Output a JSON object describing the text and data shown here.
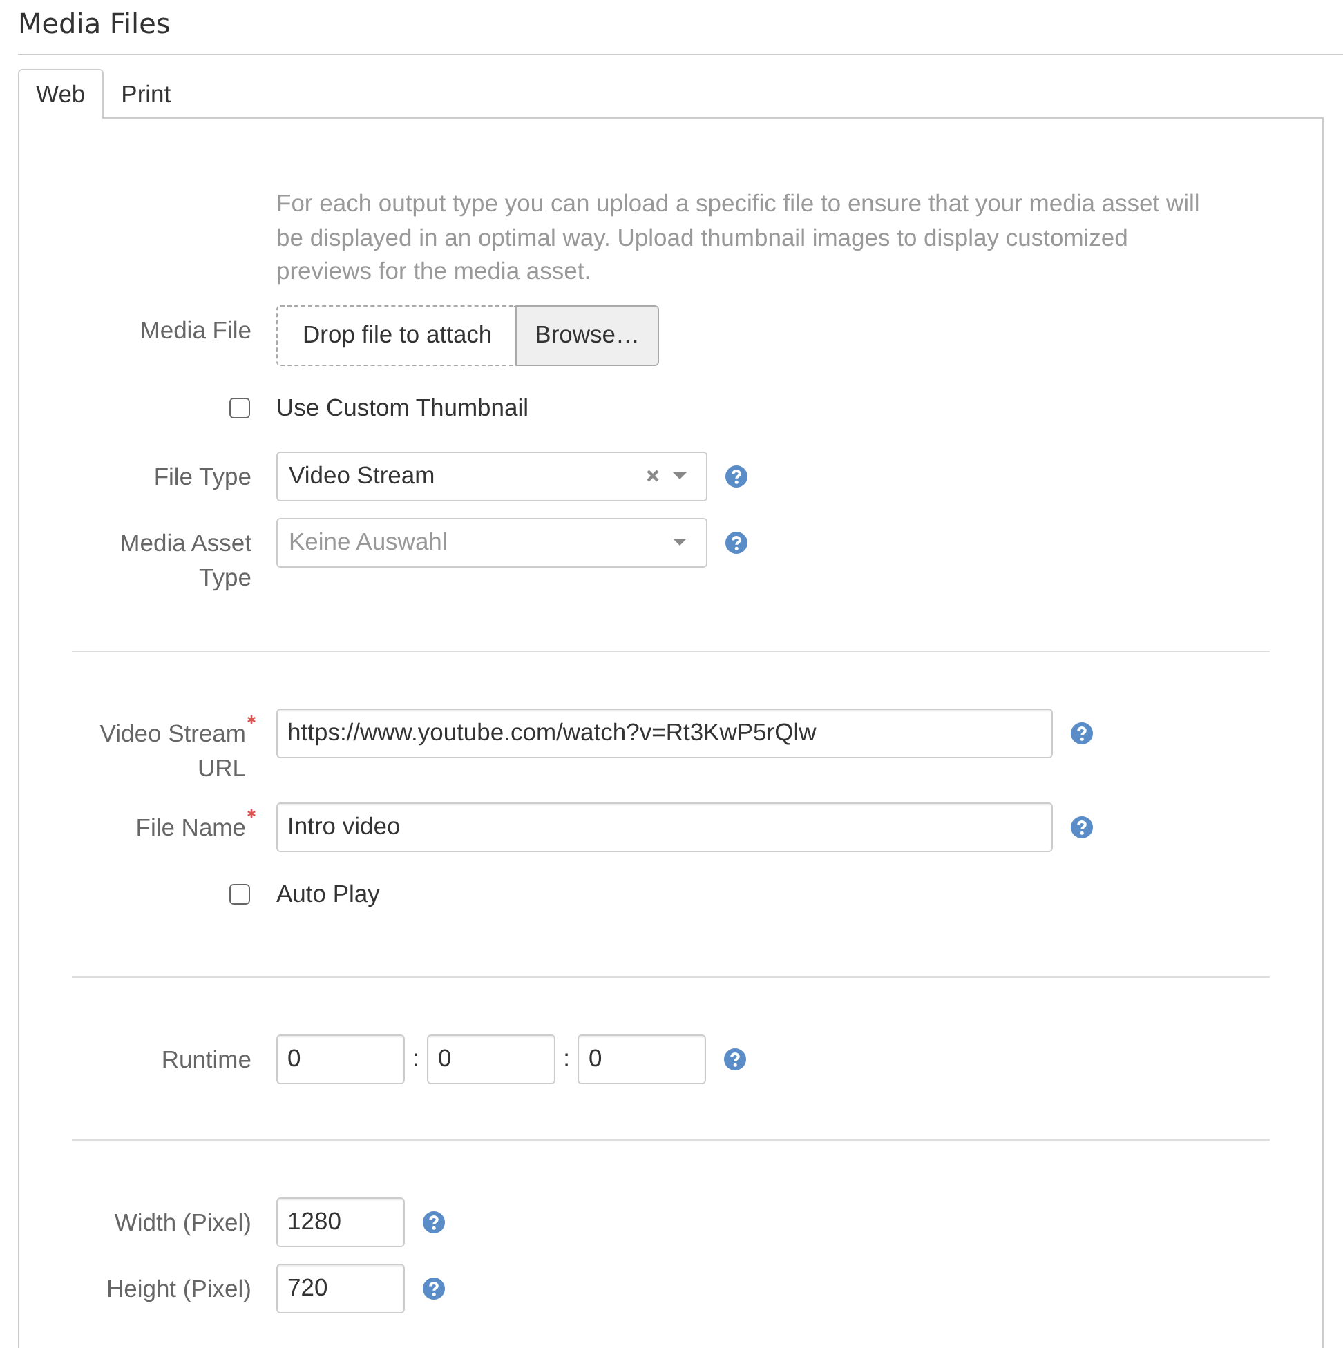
{
  "header": {
    "title": "Media Files"
  },
  "tabs": [
    {
      "label": "Web",
      "selected": true
    },
    {
      "label": "Print",
      "selected": false
    }
  ],
  "groups": [
    {
      "intro": "For each output type you can upload a specific file to ensure that your media asset will be displayed in an optimal way. Upload thumbnail images to display customized previews for the media asset.",
      "fields": [
        {
          "kind": "file",
          "label": "Media File",
          "drop_text": "Drop file to attach",
          "button": "Browse…",
          "required": false,
          "help": false
        },
        {
          "kind": "checkbox",
          "label": "Use Custom Thumbnail",
          "checked": false
        },
        {
          "kind": "select",
          "label": "File Type",
          "value": "Video Stream",
          "clearable": true,
          "required": false,
          "help": true
        },
        {
          "kind": "select",
          "label": "Media Asset Type",
          "placeholder": "Keine Auswahl",
          "clearable": false,
          "required": false,
          "help": true
        }
      ]
    },
    {
      "fields": [
        {
          "kind": "text",
          "label": "Video Stream URL",
          "value": "https://www.youtube.com/watch?v=Rt3KwP5rQlw",
          "required": true,
          "help": true
        },
        {
          "kind": "text",
          "label": "File Name",
          "value": "Intro video",
          "required": true,
          "help": true
        },
        {
          "kind": "checkbox",
          "label": "Auto Play",
          "checked": false
        }
      ]
    },
    {
      "fields": [
        {
          "kind": "runtime",
          "label": "Runtime",
          "values": [
            "0",
            "0",
            "0"
          ],
          "separators": [
            ":",
            ":"
          ],
          "required": false,
          "help": true
        }
      ]
    },
    {
      "fields": [
        {
          "kind": "number",
          "label": "Width (Pixel)",
          "value": "1280",
          "required": false,
          "help": true
        },
        {
          "kind": "number",
          "label": "Height (Pixel)",
          "value": "720",
          "required": false,
          "help": true
        }
      ]
    }
  ]
}
